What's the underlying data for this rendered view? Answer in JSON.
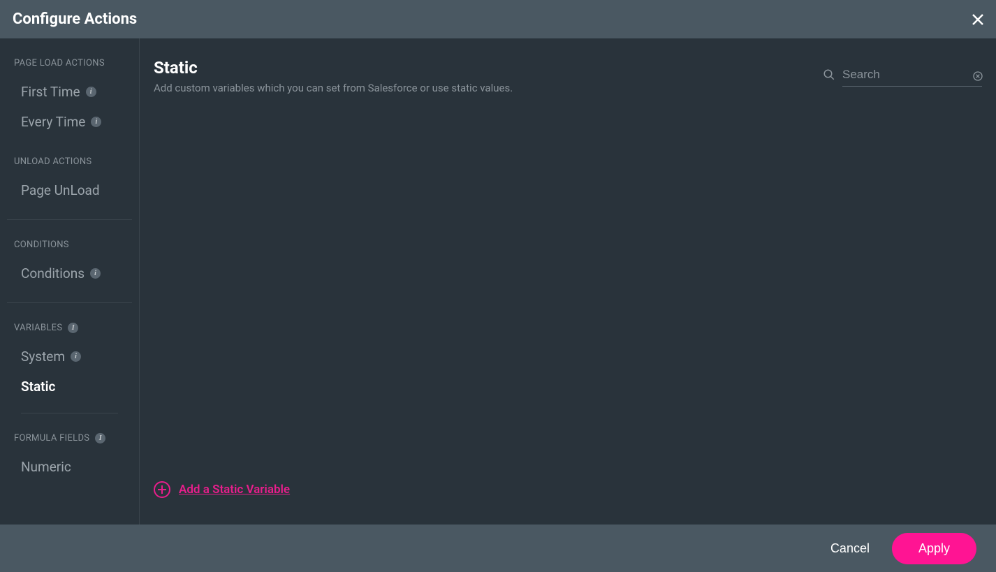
{
  "header": {
    "title": "Configure Actions"
  },
  "sidebar": {
    "sections": [
      {
        "label": "PAGE LOAD ACTIONS",
        "has_info": false,
        "items": [
          {
            "label": "First Time",
            "has_info": true,
            "active": false
          },
          {
            "label": "Every Time",
            "has_info": true,
            "active": false
          }
        ]
      },
      {
        "label": "UNLOAD ACTIONS",
        "has_info": false,
        "items": [
          {
            "label": "Page UnLoad",
            "has_info": false,
            "active": false
          }
        ],
        "divider_after": true
      },
      {
        "label": "CONDITIONS",
        "has_info": false,
        "items": [
          {
            "label": "Conditions",
            "has_info": true,
            "active": false
          }
        ],
        "divider_after": true
      },
      {
        "label": "VARIABLES",
        "has_info": true,
        "items": [
          {
            "label": "System",
            "has_info": true,
            "active": false
          },
          {
            "label": "Static",
            "has_info": false,
            "active": true
          }
        ],
        "sub_divider_after": true
      },
      {
        "label": "FORMULA FIELDS",
        "has_info": true,
        "items": [
          {
            "label": "Numeric",
            "has_info": false,
            "active": false
          }
        ]
      }
    ]
  },
  "main": {
    "title": "Static",
    "subtitle": "Add custom variables which you can set from Salesforce or use static values.",
    "search_placeholder": "Search",
    "add_label": "Add a Static Variable"
  },
  "footer": {
    "cancel": "Cancel",
    "apply": "Apply"
  },
  "colors": {
    "accent": "#ff1493",
    "bg_dark": "#29333b",
    "bg_header": "#4a5862"
  }
}
